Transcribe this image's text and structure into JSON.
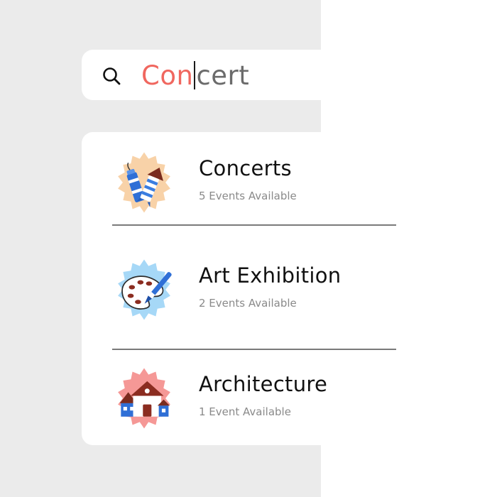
{
  "search": {
    "typed": "Con",
    "suggestion": "cert",
    "accent_color": "#f0675f"
  },
  "results": [
    {
      "icon": "fireworks-rocket-icon",
      "title": "Concerts",
      "subtitle": "5 Events Available",
      "badge_color": "#f8d2a8"
    },
    {
      "icon": "paint-palette-icon",
      "title": "Art Exhibition",
      "subtitle": "2 Events Available",
      "badge_color": "#a6d8f7"
    },
    {
      "icon": "houses-icon",
      "title": "Architecture",
      "subtitle": "1 Event Available",
      "badge_color": "#f59896"
    }
  ]
}
